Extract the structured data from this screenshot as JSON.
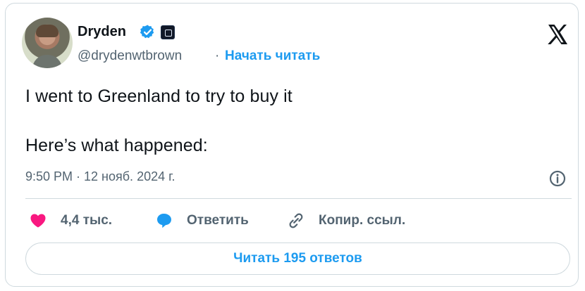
{
  "author": {
    "name": "Dryden",
    "handle": "@drydenwtbrown",
    "follow_label": "Начать читать",
    "avatar_icon": "profile-photo-avatar",
    "verified_icon": "verified-badge-icon",
    "org_icon": "organization-badge-icon"
  },
  "post": {
    "line1": "I went to Greenland to try to buy it",
    "line2": "Here’s what happened:",
    "timestamp": "9:50 PM · 12 нояб. 2024 г."
  },
  "actions": {
    "likes": "4,4 тыс.",
    "reply": "Ответить",
    "copy_link": "Копир. ссыл."
  },
  "read_replies": "Читать 195 ответов",
  "colors": {
    "brand_blue": "#1d9bf0",
    "like_pink": "#f91880",
    "text": "#0f1419",
    "muted": "#536471",
    "border": "#cfd9de"
  }
}
